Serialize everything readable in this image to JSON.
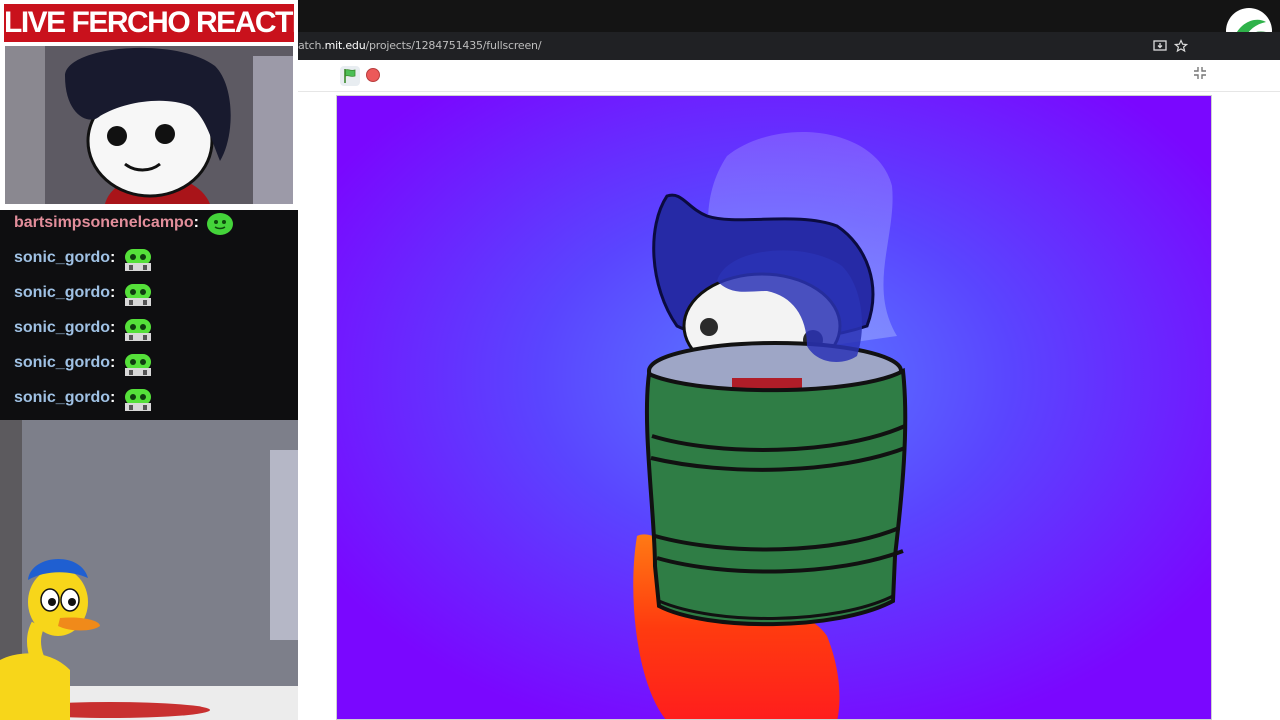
{
  "overlay": {
    "title": "LIVE FERCHO REACTION"
  },
  "browser": {
    "url_prefix": "atch.",
    "url_host": "mit.edu",
    "url_path": "/projects/1284751435/fullscreen/"
  },
  "chat": {
    "messages": [
      {
        "user": "bartsimpsonenelcampo",
        "colon": ":",
        "emote": "green-blob-emote"
      },
      {
        "user": "sonic_gordo",
        "colon": ":",
        "emote": "green-robot-emote"
      },
      {
        "user": "sonic_gordo",
        "colon": ":",
        "emote": "green-robot-emote"
      },
      {
        "user": "sonic_gordo",
        "colon": ":",
        "emote": "green-robot-emote"
      },
      {
        "user": "sonic_gordo",
        "colon": ":",
        "emote": "green-robot-emote"
      },
      {
        "user": "sonic_gordo",
        "colon": ":",
        "emote": "green-robot-emote"
      }
    ]
  },
  "colors": {
    "overlay_red": "#c9111c",
    "stage_purple": "#7b0cff",
    "barrel_green": "#2f7d45",
    "username_blue": "#9fc1e4",
    "username_pink": "#e38e9b"
  },
  "icons": [
    "green-flag-icon",
    "stop-icon",
    "fullscreen-exit-icon",
    "install-icon",
    "star-icon",
    "brand-logo-icon"
  ]
}
